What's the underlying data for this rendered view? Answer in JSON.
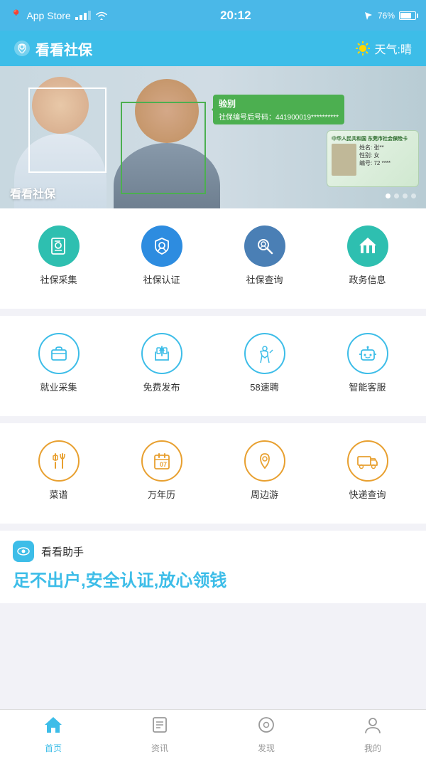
{
  "statusBar": {
    "carrier": "App Store",
    "time": "20:12",
    "battery": "76%"
  },
  "header": {
    "title": "看看社保",
    "weather": "天气:晴",
    "locationIcon": "📍"
  },
  "banner": {
    "title": "看看社保",
    "faceLabel1": "验别",
    "faceLabel2": "社保编号后号码：441900019**********",
    "dots": [
      true,
      false,
      false,
      false
    ]
  },
  "grid1": {
    "items": [
      {
        "label": "社保采集",
        "icon": "folder-user"
      },
      {
        "label": "社保认证",
        "icon": "shield-user"
      },
      {
        "label": "社保查询",
        "icon": "search-user"
      },
      {
        "label": "政务信息",
        "icon": "building"
      }
    ]
  },
  "grid2": {
    "items": [
      {
        "label": "就业采集",
        "icon": "briefcase"
      },
      {
        "label": "免费发布",
        "icon": "home-publish"
      },
      {
        "label": "58速聘",
        "icon": "run-person"
      },
      {
        "label": "智能客服",
        "icon": "robot"
      }
    ]
  },
  "grid3": {
    "items": [
      {
        "label": "菜谱",
        "icon": "fork-knife"
      },
      {
        "label": "万年历",
        "icon": "calendar"
      },
      {
        "label": "周边游",
        "icon": "location-tour"
      },
      {
        "label": "快递查询",
        "icon": "truck"
      }
    ]
  },
  "helper": {
    "icon": "eye",
    "title": "看看助手",
    "slogan": "足不出户,安全认证,放心领钱"
  },
  "tabs": [
    {
      "label": "首页",
      "icon": "home",
      "active": true
    },
    {
      "label": "资讯",
      "icon": "news",
      "active": false
    },
    {
      "label": "发现",
      "icon": "discover",
      "active": false
    },
    {
      "label": "我的",
      "icon": "profile",
      "active": false
    }
  ]
}
